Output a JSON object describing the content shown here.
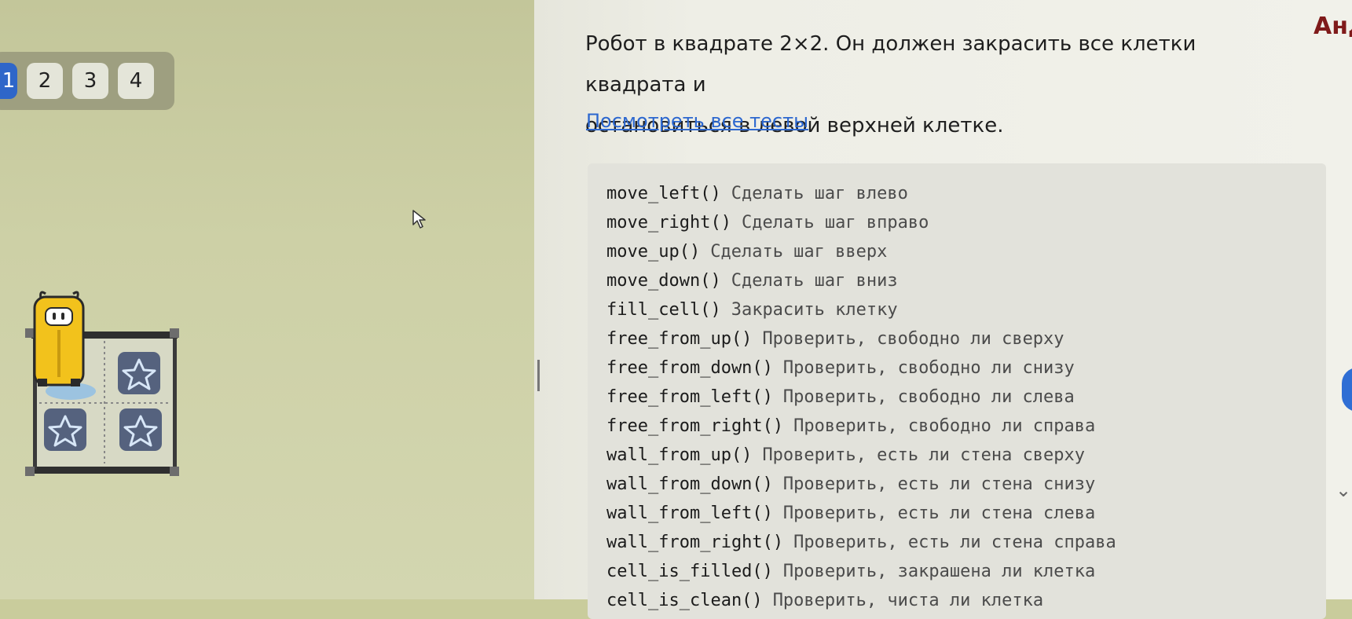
{
  "tabs": [
    {
      "label": "1",
      "active": true
    },
    {
      "label": "2",
      "active": false
    },
    {
      "label": "3",
      "active": false
    },
    {
      "label": "4",
      "active": false
    }
  ],
  "task": {
    "line1": "Робот в квадрате 2×2. Он должен закрасить все клетки квадрата и",
    "line2": "остановиться в левой верхней клетке."
  },
  "tests_link": "Посмотреть все тесты",
  "user_name": "Анд",
  "field": {
    "grid": "2x2",
    "robot_cell": "top-left",
    "star_cells": [
      "top-right",
      "bottom-left",
      "bottom-right"
    ]
  },
  "api": [
    {
      "fn": "move_left()",
      "desc": "Сделать шаг влево"
    },
    {
      "fn": "move_right()",
      "desc": "Сделать шаг вправо"
    },
    {
      "fn": "move_up()",
      "desc": "Сделать шаг вверх"
    },
    {
      "fn": "move_down()",
      "desc": "Сделать шаг вниз"
    },
    {
      "fn": "fill_cell()",
      "desc": "Закрасить клетку"
    },
    {
      "fn": "free_from_up()",
      "desc": "Проверить, свободно ли сверху"
    },
    {
      "fn": "free_from_down()",
      "desc": "Проверить, свободно ли снизу"
    },
    {
      "fn": "free_from_left()",
      "desc": "Проверить, свободно ли слева"
    },
    {
      "fn": "free_from_right()",
      "desc": "Проверить, свободно ли справа"
    },
    {
      "fn": "wall_from_up()",
      "desc": "Проверить, есть ли стена сверху"
    },
    {
      "fn": "wall_from_down()",
      "desc": "Проверить, есть ли стена снизу"
    },
    {
      "fn": "wall_from_left()",
      "desc": "Проверить, есть ли стена слева"
    },
    {
      "fn": "wall_from_right()",
      "desc": "Проверить, есть ли стена справа"
    },
    {
      "fn": "cell_is_filled()",
      "desc": "Проверить, закрашена ли клетка"
    },
    {
      "fn": "cell_is_clean()",
      "desc": "Проверить, чиста ли клетка"
    }
  ],
  "colors": {
    "accent": "#2e66c9",
    "link": "#2c67cf",
    "user_name": "#7f1a1a",
    "robot_body": "#f2c21c",
    "star_cell": "#55627e"
  },
  "icons": [
    "cursor-arrow-icon",
    "robot-icon",
    "star-icon"
  ]
}
